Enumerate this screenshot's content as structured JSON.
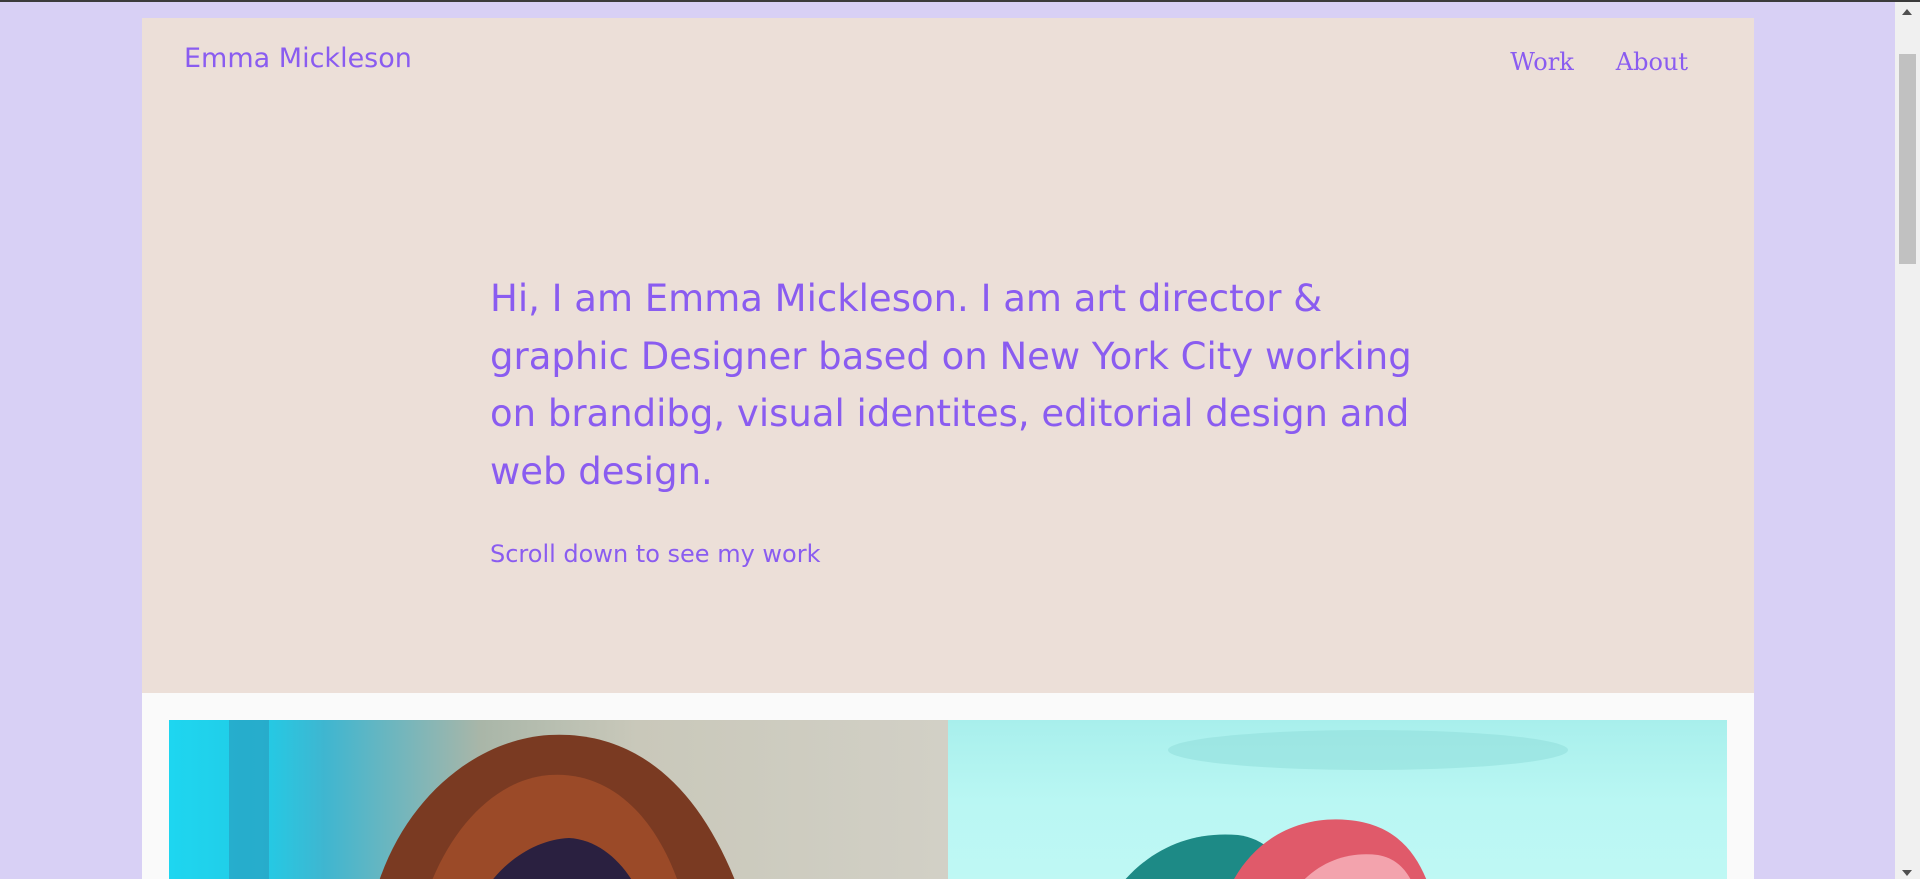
{
  "header": {
    "brand": "Emma Mickleson",
    "nav": [
      {
        "label": "Work"
      },
      {
        "label": "About"
      }
    ]
  },
  "hero": {
    "intro": "Hi, I am Emma Mickleson. I am art director & graphic Designer based on New York City working on brandibg, visual identites, editorial design and web design.",
    "scroll_hint": "Scroll down to see my work"
  },
  "colors": {
    "page_background": "#d8d0f5",
    "hero_background": "#ecdfd8",
    "accent": "#8a5cf0"
  },
  "icons": {
    "scroll_up": "triangle-up-icon",
    "scroll_down": "triangle-down-icon"
  }
}
